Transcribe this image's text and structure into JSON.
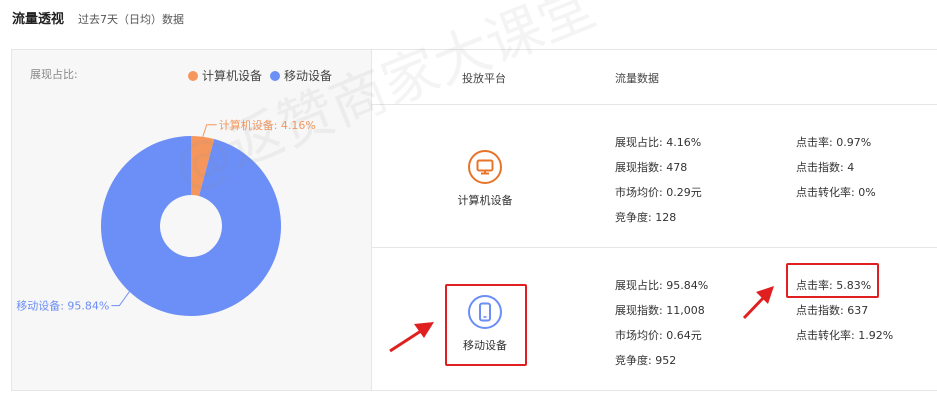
{
  "header": {
    "title": "流量透视",
    "subtitle": "过去7天（日均）数据"
  },
  "left_panel": {
    "label": "展现占比:",
    "legend": [
      {
        "name": "计算机设备",
        "color": "#f5975c"
      },
      {
        "name": "移动设备",
        "color": "#6b8ef7"
      }
    ]
  },
  "chart_data": {
    "type": "pie",
    "donut": true,
    "slices": [
      {
        "name": "计算机设备",
        "value": 4.16,
        "label": "计算机设备: 4.16%",
        "color": "#f5975c"
      },
      {
        "name": "移动设备",
        "value": 95.84,
        "label": "移动设备: 95.84%",
        "color": "#6b8ef7"
      }
    ],
    "legend_position": "top-right"
  },
  "table": {
    "headers": [
      "投放平台",
      "流量数据"
    ],
    "rows": [
      {
        "platform": "计算机设备",
        "icon": "desktop-icon",
        "color": "#e8742a",
        "col1": [
          "展现占比: 4.16%",
          "展现指数: 478",
          "市场均价: 0.29元",
          "竞争度: 128"
        ],
        "col2": [
          "点击率: 0.97%",
          "点击指数: 4",
          "点击转化率: 0%"
        ]
      },
      {
        "platform": "移动设备",
        "icon": "mobile-icon",
        "color": "#6b8ef7",
        "col1": [
          "展现占比: 95.84%",
          "展现指数: 11,008",
          "市场均价: 0.64元",
          "竞争度: 952"
        ],
        "col2": [
          "点击率: 5.83%",
          "点击指数: 637",
          "点击转化率: 1.92%"
        ]
      }
    ]
  },
  "watermark": "@返赞商家大课堂"
}
